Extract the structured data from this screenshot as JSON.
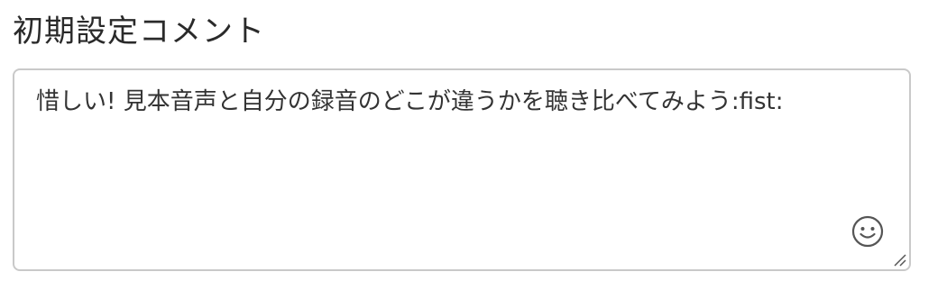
{
  "field": {
    "label": "初期設定コメント",
    "value": "惜しい! 見本音声と自分の録音のどこが違うかを聴き比べてみよう:fist:"
  },
  "icons": {
    "emoji": "smiley-face-icon",
    "resize": "resize-grip-icon"
  },
  "colors": {
    "border": "#c9c9c9",
    "text": "#333333",
    "icon": "#555555"
  }
}
